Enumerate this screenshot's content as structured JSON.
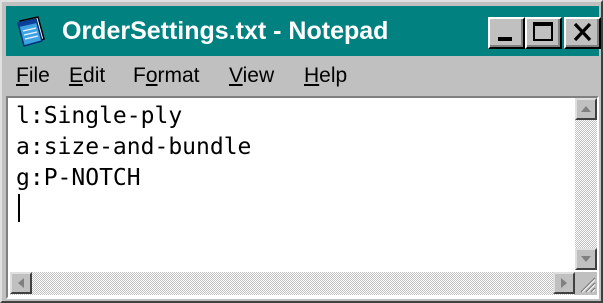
{
  "window": {
    "title": "OrderSettings.txt - Notepad",
    "app_icon": "notepad-icon",
    "title_bar_color": "#018280",
    "controls": [
      {
        "name": "minimize",
        "icon": "minimize-icon"
      },
      {
        "name": "maximize",
        "icon": "maximize-icon"
      },
      {
        "name": "close",
        "icon": "close-icon"
      }
    ]
  },
  "menu": {
    "items": [
      {
        "label": "File",
        "accel": "F",
        "rest": "ile"
      },
      {
        "label": "Edit",
        "accel": "E",
        "rest": "dit"
      },
      {
        "label": "Format",
        "pre": "F",
        "accel": "o",
        "rest": "rmat"
      },
      {
        "label": "View",
        "accel": "V",
        "rest": "iew"
      },
      {
        "label": "Help",
        "accel": "H",
        "rest": "elp"
      }
    ]
  },
  "editor": {
    "lines": [
      "l:Single-ply",
      "a:size-and-bundle",
      "g:P-NOTCH",
      ""
    ]
  },
  "scrollbars": {
    "vertical_icons": [
      "scroll-up-icon",
      "scroll-down-icon"
    ],
    "horizontal_icons": [
      "scroll-left-icon",
      "scroll-right-icon"
    ]
  }
}
